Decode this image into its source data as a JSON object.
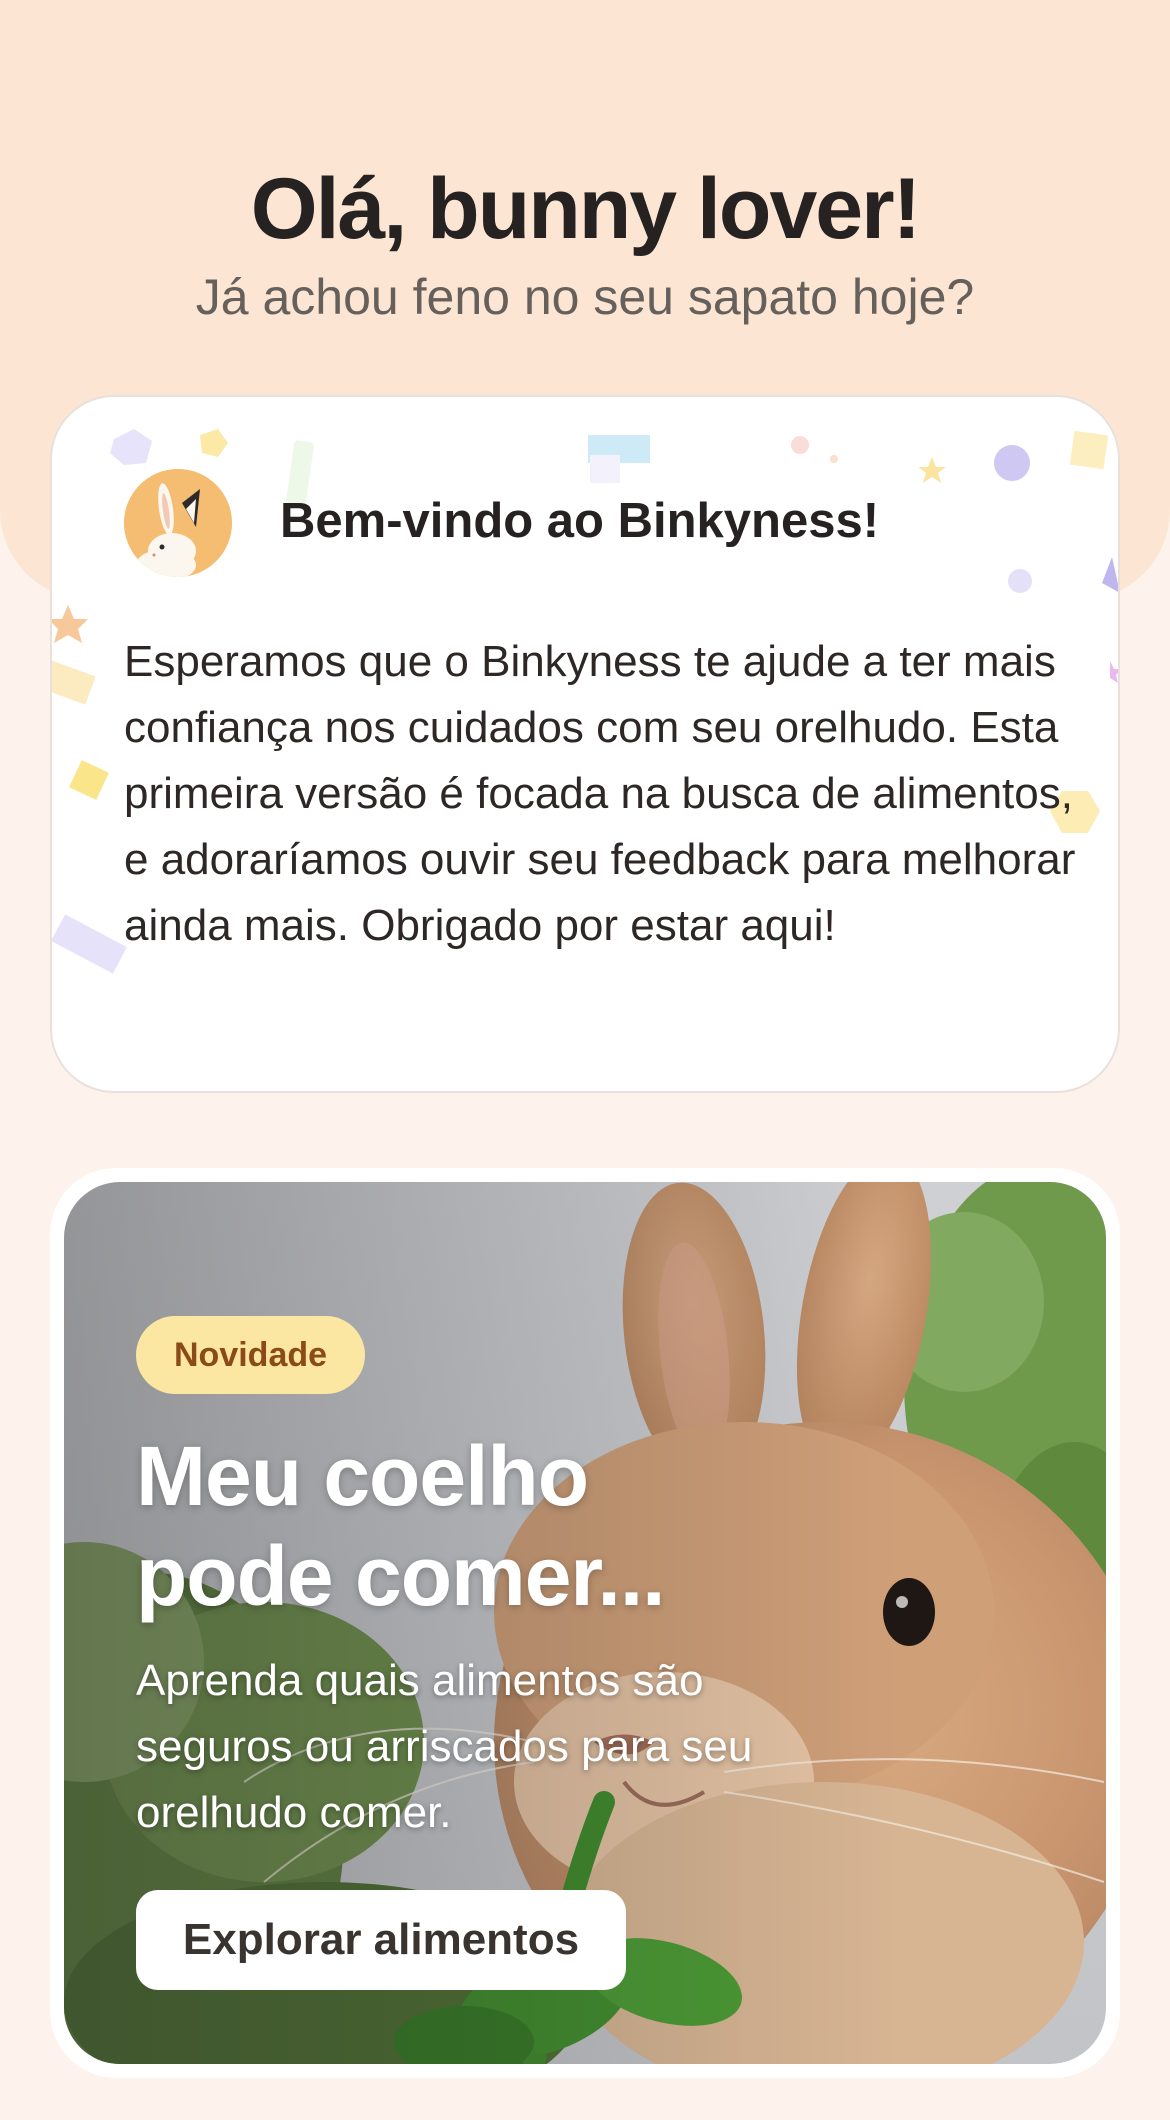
{
  "header": {
    "greeting": "Olá, bunny lover!",
    "subtitle": "Já achou feno no seu sapato hoje?"
  },
  "welcome_card": {
    "avatar_icon": "bunny-avatar-icon",
    "title": "Bem-vindo ao Binkyness!",
    "body": "Esperamos que o Binkyness te ajude a ter mais confiança nos cuidados com seu orelhudo. Esta primeira versão é focada na busca de alimentos, e adoraríamos ouvir seu feedback para melhorar ainda mais. Obrigado por estar aqui!"
  },
  "feature_card": {
    "badge": "Novidade",
    "title": "Meu coelho pode comer...",
    "description": "Aprenda quais alimentos são seguros ou arriscados para seu orelhudo comer.",
    "cta_label": "Explorar alimentos",
    "image": "rabbit-eating-greens-photo"
  },
  "colors": {
    "background": "#fdf3ec",
    "header_background": "#fce6d3",
    "badge_background": "#fbe7a1",
    "badge_text": "#8a4a1a",
    "avatar_background": "#f4bd72"
  }
}
